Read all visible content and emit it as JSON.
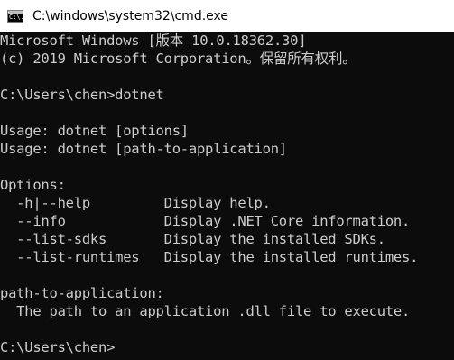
{
  "window": {
    "title": "C:\\windows\\system32\\cmd.exe",
    "icon": "cmd-icon",
    "icon_glyph": "C:\\."
  },
  "console": {
    "lines": [
      "Microsoft Windows [版本 10.0.18362.30]",
      "(c) 2019 Microsoft Corporation。保留所有权利。",
      "",
      "C:\\Users\\chen>dotnet",
      "",
      "Usage: dotnet [options]",
      "Usage: dotnet [path-to-application]",
      "",
      "Options:",
      "  -h|--help         Display help.",
      "  --info            Display .NET Core information.",
      "  --list-sdks       Display the installed SDKs.",
      "  --list-runtimes   Display the installed runtimes.",
      "",
      "path-to-application:",
      "  The path to an application .dll file to execute.",
      "",
      "C:\\Users\\chen>"
    ]
  }
}
